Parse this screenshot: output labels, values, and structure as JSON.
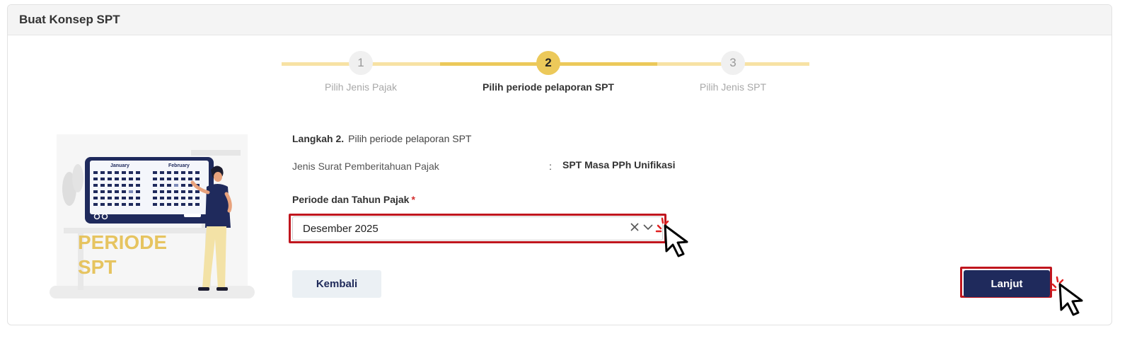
{
  "card": {
    "title": "Buat Konsep SPT"
  },
  "stepper": {
    "steps": [
      {
        "number": "1",
        "label": "Pilih Jenis Pajak",
        "active": false
      },
      {
        "number": "2",
        "label": "Pilih periode pelaporan SPT",
        "active": true
      },
      {
        "number": "3",
        "label": "Pilih Jenis SPT",
        "active": false
      }
    ]
  },
  "illustration": {
    "caption_line1": "PERIODE",
    "caption_line2": "SPT",
    "month1": "January",
    "month2": "February"
  },
  "form": {
    "step_prefix": "Langkah 2.",
    "step_text": "Pilih periode pelaporan SPT",
    "info_label": "Jenis Surat Pemberitahuan Pajak",
    "info_colon": ":",
    "info_value": "SPT Masa PPh Unifikasi",
    "period_label": "Periode dan Tahun Pajak",
    "required_mark": "*",
    "period_value": "Desember 2025"
  },
  "buttons": {
    "back": "Kembali",
    "next": "Lanjut"
  },
  "colors": {
    "accent_yellow": "#ecc95a",
    "primary_navy": "#1f2a5c",
    "highlight_red": "#c0161e"
  }
}
